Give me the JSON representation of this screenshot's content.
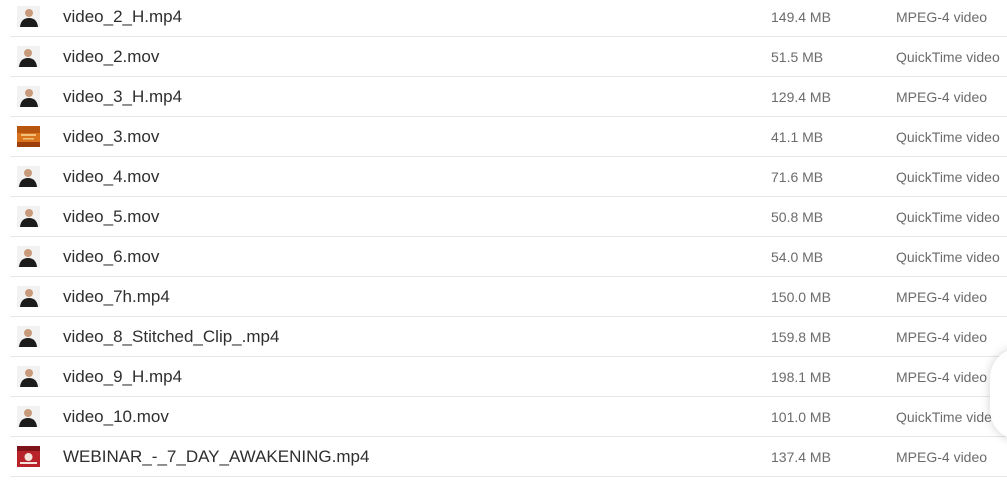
{
  "files": [
    {
      "name": "video_2_H.mp4",
      "size": "149.4 MB",
      "kind": "MPEG-4 video",
      "thumb": "person-icon"
    },
    {
      "name": "video_2.mov",
      "size": "51.5 MB",
      "kind": "QuickTime video",
      "thumb": "person-icon"
    },
    {
      "name": "video_3_H.mp4",
      "size": "129.4 MB",
      "kind": "MPEG-4 video",
      "thumb": "person-icon"
    },
    {
      "name": "video_3.mov",
      "size": "41.1 MB",
      "kind": "QuickTime video",
      "thumb": "orange-frame-icon"
    },
    {
      "name": "video_4.mov",
      "size": "71.6 MB",
      "kind": "QuickTime video",
      "thumb": "person-icon"
    },
    {
      "name": "video_5.mov",
      "size": "50.8 MB",
      "kind": "QuickTime video",
      "thumb": "person-icon"
    },
    {
      "name": "video_6.mov",
      "size": "54.0 MB",
      "kind": "QuickTime video",
      "thumb": "person-icon"
    },
    {
      "name": "video_7h.mp4",
      "size": "150.0 MB",
      "kind": "MPEG-4 video",
      "thumb": "person-icon"
    },
    {
      "name": "video_8_Stitched_Clip_.mp4",
      "size": "159.8 MB",
      "kind": "MPEG-4 video",
      "thumb": "person-icon"
    },
    {
      "name": "video_9_H.mp4",
      "size": "198.1 MB",
      "kind": "MPEG-4 video",
      "thumb": "person-icon"
    },
    {
      "name": "video_10.mov",
      "size": "101.0 MB",
      "kind": "QuickTime video",
      "thumb": "person-icon"
    },
    {
      "name": "WEBINAR_-_7_DAY_AWAKENING.mp4",
      "size": "137.4 MB",
      "kind": "MPEG-4 video",
      "thumb": "webinar-frame-icon"
    }
  ],
  "colors": {
    "text_primary": "#2e2e2e",
    "text_secondary": "#6b6b6b",
    "divider": "#e6e6e6"
  }
}
